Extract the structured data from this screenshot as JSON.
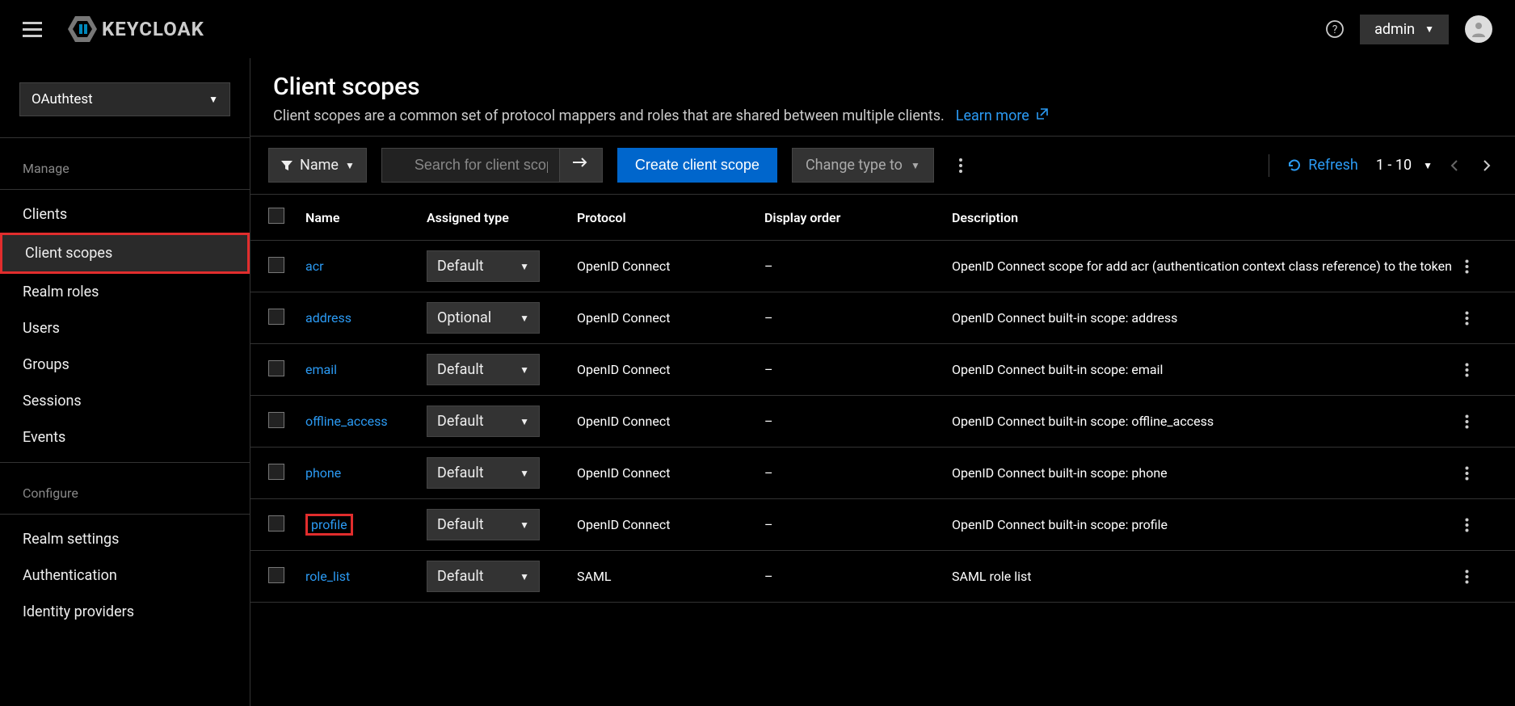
{
  "header": {
    "logo_text": "KEYCLOAK",
    "username": "admin"
  },
  "sidebar": {
    "realm": "OAuthtest",
    "section_manage": "Manage",
    "section_configure": "Configure",
    "manage_items": [
      "Clients",
      "Client scopes",
      "Realm roles",
      "Users",
      "Groups",
      "Sessions",
      "Events"
    ],
    "configure_items": [
      "Realm settings",
      "Authentication",
      "Identity providers"
    ],
    "active_item": "Client scopes"
  },
  "page": {
    "title": "Client scopes",
    "description": "Client scopes are a common set of protocol mappers and roles that are shared between multiple clients.",
    "learn_more": "Learn more"
  },
  "toolbar": {
    "filter_label": "Name",
    "search_placeholder": "Search for client scope",
    "create_label": "Create client scope",
    "change_type_label": "Change type to",
    "refresh_label": "Refresh",
    "pager_range": "1 - 10"
  },
  "table": {
    "columns": [
      "Name",
      "Assigned type",
      "Protocol",
      "Display order",
      "Description"
    ],
    "rows": [
      {
        "name": "acr",
        "assigned": "Default",
        "protocol": "OpenID Connect",
        "display": "–",
        "desc": "OpenID Connect scope for add acr (authentication context class reference) to the token",
        "highlight": false
      },
      {
        "name": "address",
        "assigned": "Optional",
        "protocol": "OpenID Connect",
        "display": "–",
        "desc": "OpenID Connect built-in scope: address",
        "highlight": false
      },
      {
        "name": "email",
        "assigned": "Default",
        "protocol": "OpenID Connect",
        "display": "–",
        "desc": "OpenID Connect built-in scope: email",
        "highlight": false
      },
      {
        "name": "offline_access",
        "assigned": "Default",
        "protocol": "OpenID Connect",
        "display": "–",
        "desc": "OpenID Connect built-in scope: offline_access",
        "highlight": false
      },
      {
        "name": "phone",
        "assigned": "Default",
        "protocol": "OpenID Connect",
        "display": "–",
        "desc": "OpenID Connect built-in scope: phone",
        "highlight": false
      },
      {
        "name": "profile",
        "assigned": "Default",
        "protocol": "OpenID Connect",
        "display": "–",
        "desc": "OpenID Connect built-in scope: profile",
        "highlight": true
      },
      {
        "name": "role_list",
        "assigned": "Default",
        "protocol": "SAML",
        "display": "–",
        "desc": "SAML role list",
        "highlight": false
      }
    ]
  }
}
